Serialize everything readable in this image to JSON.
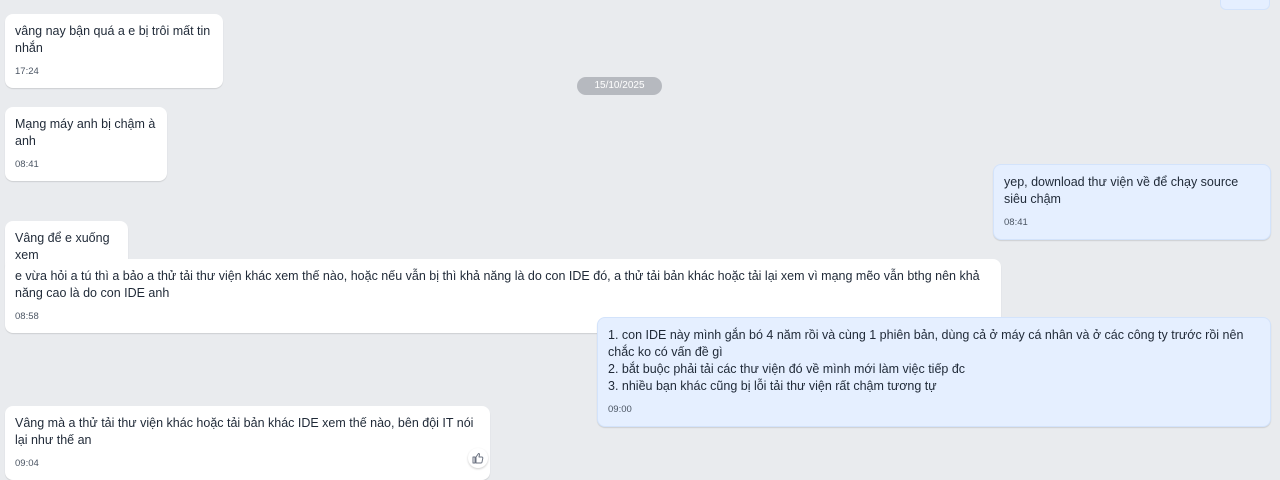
{
  "messages": [
    {
      "text": "vâng nay bận quá a e bị trôi mất tin nhắn",
      "time": "17:24"
    },
    {
      "text": "Mạng máy anh bị chậm à anh",
      "time": "08:41"
    },
    {
      "text": "yep, download thư viện về để chạy source siêu chậm",
      "time": "08:41"
    },
    {
      "text": "Vâng để e xuống xem",
      "time": ""
    },
    {
      "text": "e vừa hỏi a tú thì a bảo a thử tải thư viện khác xem thế nào, hoặc nếu vẫn bị thì khả năng là do con IDE đó, a thử tải bản khác hoặc tải lại xem vì mạng mẽo vẫn bthg nên khả năng cao là do con IDE anh",
      "time": "08:58"
    },
    {
      "text": "1. con IDE này mình gắn bó 4 năm rồi và cùng 1 phiên bản, dùng cả ở máy cá nhân và ở các công ty trước rồi nên chắc ko có vấn đề gì\n2. bắt buộc phải tải các thư viện đó về mình mới làm việc tiếp đc\n3. nhiều bạn khác cũng bị lỗi tải thư viện rất chậm tương tự",
      "time": "09:00"
    },
    {
      "text": "Vâng mà a thử tải thư viện khác hoặc tải bản khác IDE xem thế nào, bên đội IT nói lại như thế an",
      "time": "09:04"
    }
  ],
  "date_separator": "15/10/2025",
  "reaction_icon": "thumbs-up-icon"
}
